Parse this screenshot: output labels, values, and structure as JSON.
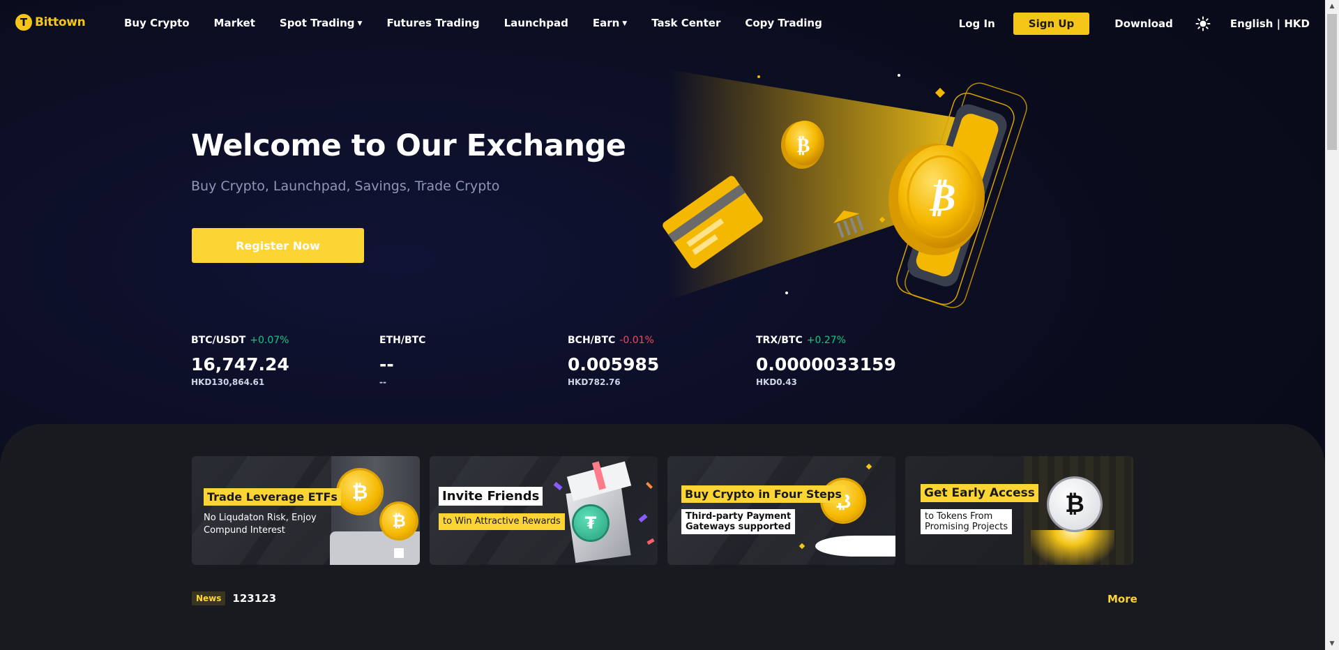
{
  "brand": {
    "name": "Bittown",
    "accent": "#fcd535",
    "up_color": "#0ecb81",
    "down_color": "#f6465d"
  },
  "nav": {
    "items": [
      {
        "label": "Buy Crypto",
        "has_caret": false
      },
      {
        "label": "Market",
        "has_caret": false
      },
      {
        "label": "Spot Trading",
        "has_caret": true
      },
      {
        "label": "Futures Trading",
        "has_caret": false
      },
      {
        "label": "Launchpad",
        "has_caret": false
      },
      {
        "label": "Earn",
        "has_caret": true
      },
      {
        "label": "Task Center",
        "has_caret": false
      },
      {
        "label": "Copy Trading",
        "has_caret": false
      }
    ],
    "login": "Log In",
    "signup": "Sign Up",
    "download": "Download",
    "theme_icon": "sun-icon",
    "language": "English | HKD"
  },
  "hero": {
    "title": "Welcome to Our Exchange",
    "subtitle": "Buy Crypto, Launchpad, Savings, Trade Crypto",
    "register": "Register Now"
  },
  "tickers": [
    {
      "pair": "BTC/USDT",
      "change": "+0.07%",
      "direction": "up",
      "price": "16,747.24",
      "fiat": "HKD130,864.61"
    },
    {
      "pair": "ETH/BTC",
      "change": "",
      "direction": "none",
      "price": "--",
      "fiat": "--"
    },
    {
      "pair": "BCH/BTC",
      "change": "-0.01%",
      "direction": "down",
      "price": "0.005985",
      "fiat": "HKD782.76"
    },
    {
      "pair": "TRX/BTC",
      "change": "+0.27%",
      "direction": "up",
      "price": "0.0000033159",
      "fiat": "HKD0.43"
    }
  ],
  "banners": [
    {
      "title": "Trade Leverage ETFs",
      "sub1": "No Liqudaton Risk, Enjoy",
      "sub2": "Compund Interest"
    },
    {
      "title": "Invite Friends",
      "sub1": "to Win Attractive Rewards"
    },
    {
      "title": "Buy Crypto in Four Steps",
      "sub1": "Third-party Payment",
      "sub2": "Gateways supported"
    },
    {
      "title": "Get Early Access",
      "sub1": "to Tokens From",
      "sub2": "Promising Projects"
    }
  ],
  "news": {
    "badge": "News",
    "text": "123123",
    "more": "More"
  }
}
